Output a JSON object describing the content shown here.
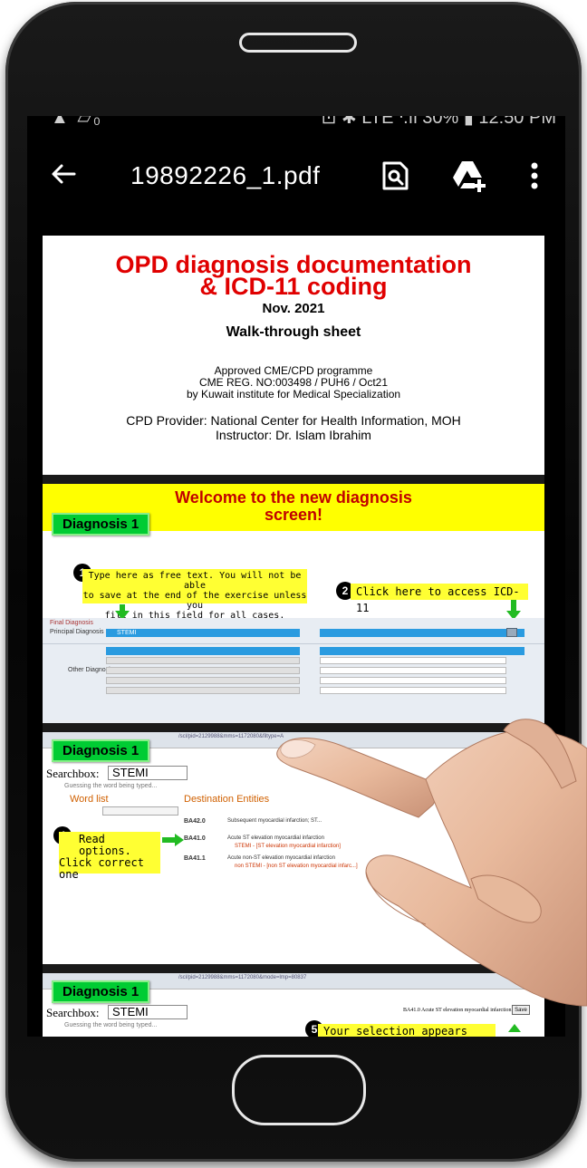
{
  "statusbar": {
    "left": "▲ ▱₀",
    "right": "⊡ ✱ LTE ᐧ.ıl 30% ▮ 12:50 PM"
  },
  "appbar": {
    "filename": "19892226_1.pdf",
    "back_icon": "arrow-left-icon",
    "search_icon": "find-in-page-icon",
    "drive_icon": "add-to-drive-icon",
    "more_icon": "more-vert-icon"
  },
  "page1": {
    "title_line1": "OPD diagnosis documentation",
    "title_line2": "& ICD-11 coding",
    "date": "Nov. 2021",
    "subtitle": "Walk-through sheet",
    "cme_line1": "Approved CME/CPD programme",
    "cme_line2": "CME REG. NO:003498 / PUH6 / Oct21",
    "cme_line3": "by Kuwait institute for Medical Specialization",
    "cpd_line1": "CPD Provider: National Center for Health Information, MOH",
    "cpd_line2": "Instructor: Dr. Islam Ibrahim"
  },
  "page2": {
    "title_line1": "Welcome to the new diagnosis",
    "title_line2": "screen!",
    "diagnosis_tag": "Diagnosis 1",
    "step1_num": "1",
    "step1_text_1": "Type here as free text. You will not be able",
    "step1_text_2": "to save at the end of the exercise unless you",
    "step1_text_3": "fill in this field for all cases.",
    "step2_num": "2",
    "step2_text": "Click here to access ICD-11",
    "final_diagnosis_label": "Final Diagnosis",
    "principal_label": "Principal Diagnosis",
    "principal_value": "STEMI",
    "other_label": "Other Diagnosis"
  },
  "page3": {
    "diagnosis_tag": "Diagnosis 1",
    "searchbox_label": "Searchbox:",
    "searchbox_value": "STEMI",
    "guessing_text": "Guessing the word being typed...",
    "wordlist_head": "Word list",
    "destination_head": "Destination Entities",
    "step4_num": "4",
    "step4_text_1": "Read options.",
    "step4_text_2": "Click correct",
    "step4_text_3": "one",
    "codes": [
      {
        "code": "BA42.0",
        "text": "Subsequent myocardial infarction; ST..."
      },
      {
        "code": "BA41.0",
        "text": "Acute ST elevation myocardial infarction",
        "sub": "STEMI - [ST elevation myocardial infarction]"
      },
      {
        "code": "BA41.1",
        "text": "Acute non-ST elevation myocardial infarction",
        "sub": "non STEMI - [non ST elevation myocardial infarc...]"
      }
    ]
  },
  "page4": {
    "diagnosis_tag": "Diagnosis 1",
    "searchbox_label": "Searchbox:",
    "searchbox_value": "STEMI",
    "guessing_text": "Guessing the word being typed...",
    "selection_text": "BA41.0 Acute ST elevation myocardial infarction",
    "save_label": "Save",
    "step5_num": "5",
    "step5_text": "Your selection appears here."
  }
}
